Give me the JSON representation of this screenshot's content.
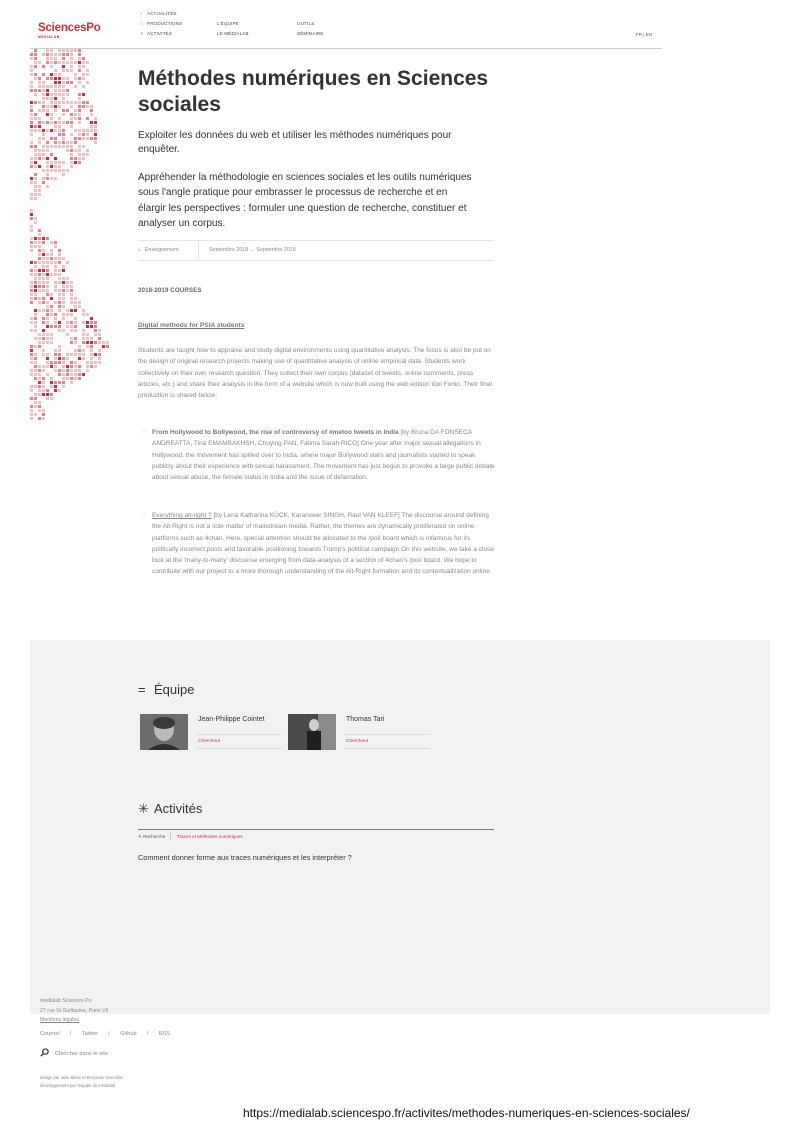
{
  "brand": {
    "name": "SciencesPo",
    "sub": "MÉDIALAB"
  },
  "nav": {
    "items": [
      {
        "label": "ACTUALITÉS",
        "mark": "+"
      },
      {
        "label": "PRODUCTIONS",
        "mark": "□"
      },
      {
        "label": "ACTIVITÉS",
        "mark": "✳"
      },
      {
        "label": "L'ÉQUIPE"
      },
      {
        "label": "LE MÉDIALAB"
      },
      {
        "label": "OUTILS"
      },
      {
        "label": "SÉMINAIRE"
      }
    ],
    "lang": "FR | EN"
  },
  "page": {
    "title": "Méthodes numériques en Sciences sociales",
    "lead": "Exploiter les données du web et utiliser les méthodes numériques pour enquêter.",
    "description": "Appréhender la méthodologie en sciences sociales et les outils numériques sous l'angle pratique pour embrasser le processus de recherche et en élargir les perspectives : formuler une question de recherche, constituer et analyser un corpus.",
    "meta": {
      "bullet": "●",
      "type": "Enseignement",
      "dates": "Septembre 2018 → Septembre 2019"
    },
    "section_heading": "2018-2019 COURSES",
    "course_title": "Digital methods for PSIA students",
    "course_intro": "Students are taught how to appraise and study digital environments using quantitative analysis. The focus is also be put on the design of original research projects making use of quantitative analysis of online empirical data. Students work collectively on their own research question. They collect their own corpus (dataset of tweets, online comments, press articles, etc.) and share their analysis in the form of a website which is now built using the web edition tool Fonio. Their final production is shared below:",
    "projects": [
      {
        "bullet": "◇",
        "title": "From Hollywood to Bollywood, the rise of controversy of #metoo tweets in India",
        "text": "[by Bruna DA FONSECA ANDREATTA, Tina EMAMBAKHSH, Chuying PAN, Fatima Sarah RICO] One year after major sexual allegations in Hollywood, the movement has spilled over to India, where major Bollywood stars and journalists started to speak publicly about their experience with sexual harassment. The movement has just begun to provoke a large public debate about sexual abuse, the female status in India and the issue of defamation."
      },
      {
        "bullet": "◇",
        "title": "Everything alt-right ?",
        "text": "[by Lena Katharina KÜCK, Karanveer SINGH, Raul VAN KLEEF] The discourse around defining the Alt-Right is not a sole matter of mainstream media. Rather, the themes are dynamically proliferated on online platforms such as 4chan. Here, special attention should be allocated to the /pol/ board which is infamous for its politically incorrect posts and favorable positioning towards Trump's political campaign.On this website, we take a close look at the 'many-to-many' discourse emerging from data-analysis of a section of 4chan's /pol/ board. We hope to contribute with our project to a more thorough understanding of the Alt-Right formation and its contextualization online."
      }
    ]
  },
  "team": {
    "symbol": "=",
    "heading": "Équipe",
    "members": [
      {
        "name": "Jean-Philippe Cointet",
        "role": "Chercheur"
      },
      {
        "name": "Thomas Tari",
        "role": "Chercheur"
      }
    ]
  },
  "activities": {
    "symbol": "✳",
    "heading": "Activités",
    "tag_primary": "✳ Recherche",
    "tag_secondary": "Traces et Méthodes numériques",
    "question": "Comment donner forme aux traces numériques et les interpréter ?"
  },
  "footer": {
    "name": "médialab Sciences Po",
    "address": "27 rue St Guillaume, Paris VII",
    "legal": "Mentions légales",
    "links": [
      "Courriel",
      "Twitter",
      "Github",
      "RSS"
    ],
    "link_sep": "/",
    "search_placeholder": "Chercher dans le site",
    "credit_design": "design par Julie Blanc et Benjamin Gremillon",
    "credit_dev": "développement par l'équipe du médialab"
  },
  "url": "https://medialab.sciencespo.fr/activites/methodes-numeriques-en-sciences-sociales/",
  "colors": {
    "accent": "#d42a35",
    "band": "#f2f2f2",
    "mosaic_light": "#f3bfc3",
    "mosaic_mid": "#e8818a"
  }
}
